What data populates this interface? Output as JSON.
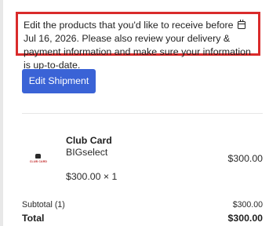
{
  "notice": {
    "text_before_date": "Edit the products that you'd like to receive before",
    "date": "Jul 16, 2026.",
    "text_after_date": "Please also review your delivery & payment information and make sure your information is up-to-date.",
    "icon": "calendar-icon",
    "border_color": "#d92b2b"
  },
  "actions": {
    "edit_shipment_label": "Edit Shipment",
    "button_color": "#3a63d6"
  },
  "product": {
    "thumbnail_icon": "club-card-thumbnail",
    "thumbnail_text": "CLUB CARD",
    "name": "Club Card",
    "variant": "BIGselect",
    "unit_price_quantity": "$300.00 × 1",
    "line_total": "$300.00"
  },
  "summary": {
    "subtotal_label": "Subtotal (1)",
    "subtotal_value": "$300.00",
    "total_label": "Total",
    "total_value": "$300.00"
  }
}
